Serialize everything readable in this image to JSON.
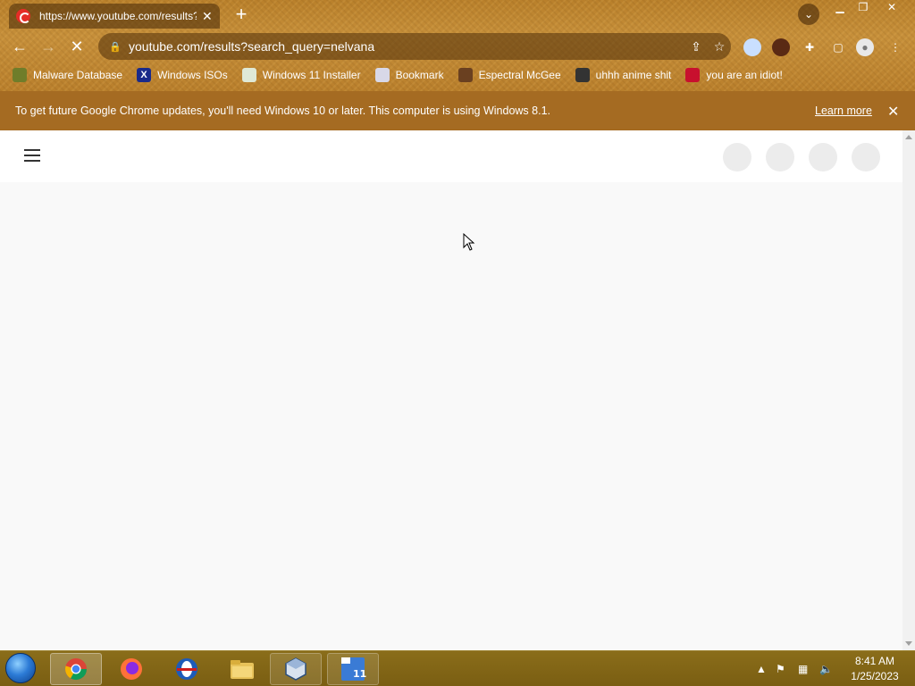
{
  "browser": {
    "tab": {
      "title": "https://www.youtube.com/results?search_query=nelvana",
      "favicon": "youtube-icon"
    },
    "address_bar": {
      "url": "youtube.com/results?search_query=nelvana"
    },
    "bookmarks": [
      {
        "label": "Malware Database",
        "icon": "green-leaf-icon"
      },
      {
        "label": "Windows ISOs",
        "icon": "x-icon"
      },
      {
        "label": "Windows 11 Installer",
        "icon": "image-icon"
      },
      {
        "label": "Bookmark",
        "icon": "globe-icon"
      },
      {
        "label": "Espectral McGee",
        "icon": "avatar-icon"
      },
      {
        "label": "uhhh anime shit",
        "icon": "anime-face-icon"
      },
      {
        "label": "you are an idiot!",
        "icon": "flag-icon"
      }
    ],
    "infobar": {
      "message": "To get future Google Chrome updates, you'll need Windows 10 or later. This computer is using Windows 8.1.",
      "link": "Learn more"
    }
  },
  "taskbar": {
    "apps": [
      "Google Chrome",
      "Firefox",
      "Opera",
      "File Explorer",
      "VirtualBox",
      "Windows 11"
    ],
    "clock": {
      "time": "8:41 AM",
      "date": "1/25/2023"
    }
  },
  "colors": {
    "chrome_frame": "#b9802b",
    "infobar": "#a56b22",
    "taskbar": "#7a5e12",
    "youtube_red": "#e52d27"
  }
}
